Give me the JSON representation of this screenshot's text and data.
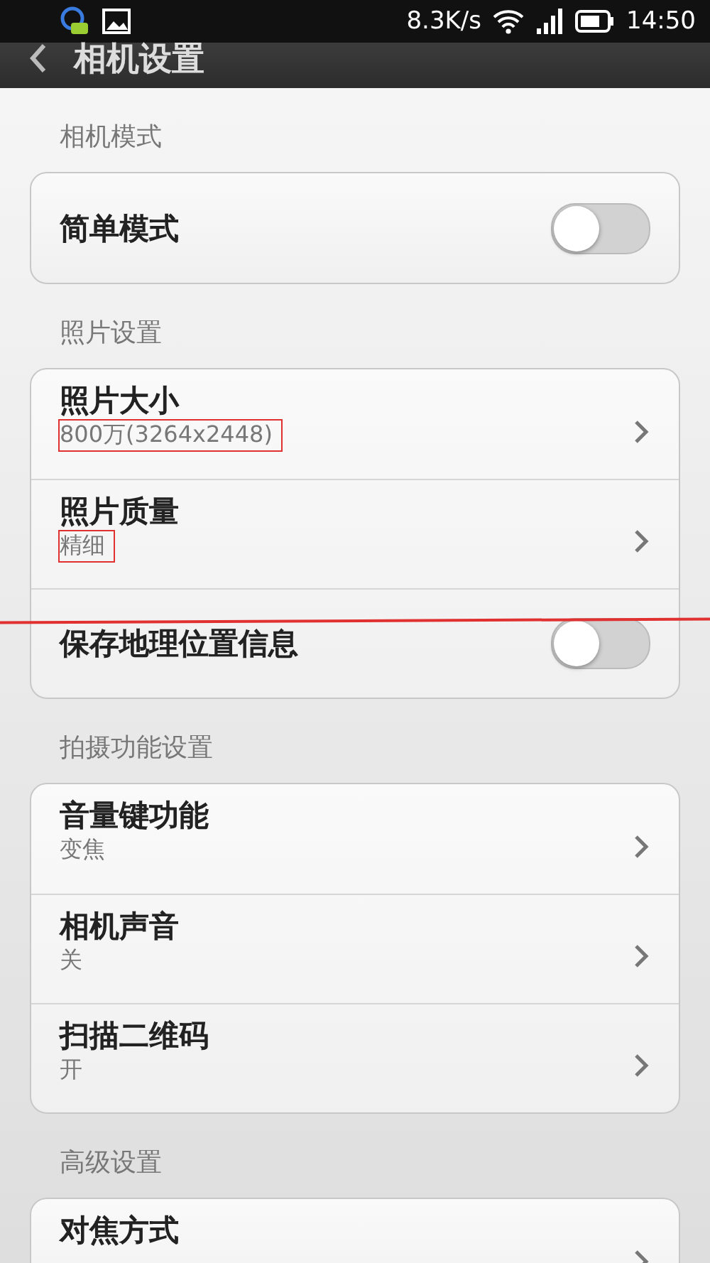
{
  "status_bar": {
    "speed": "8.3K/s",
    "time": "14:50"
  },
  "header": {
    "title": "相机设置"
  },
  "sections": [
    {
      "title": "相机模式",
      "items": [
        {
          "kind": "toggle",
          "label": "简单模式",
          "on": false
        }
      ]
    },
    {
      "title": "照片设置",
      "items": [
        {
          "kind": "link",
          "label": "照片大小",
          "value": "800万(3264x2448)",
          "highlighted": true
        },
        {
          "kind": "link",
          "label": "照片质量",
          "value": "精细",
          "highlighted": true
        },
        {
          "kind": "toggle",
          "label": "保存地理位置信息",
          "on": false,
          "annotation_line": true
        }
      ]
    },
    {
      "title": "拍摄功能设置",
      "items": [
        {
          "kind": "link",
          "label": "音量键功能",
          "value": "变焦"
        },
        {
          "kind": "link",
          "label": "相机声音",
          "value": "关"
        },
        {
          "kind": "link",
          "label": "扫描二维码",
          "value": "开"
        }
      ]
    },
    {
      "title": "高级设置",
      "items": [
        {
          "kind": "link",
          "label": "对焦方式"
        }
      ]
    }
  ]
}
